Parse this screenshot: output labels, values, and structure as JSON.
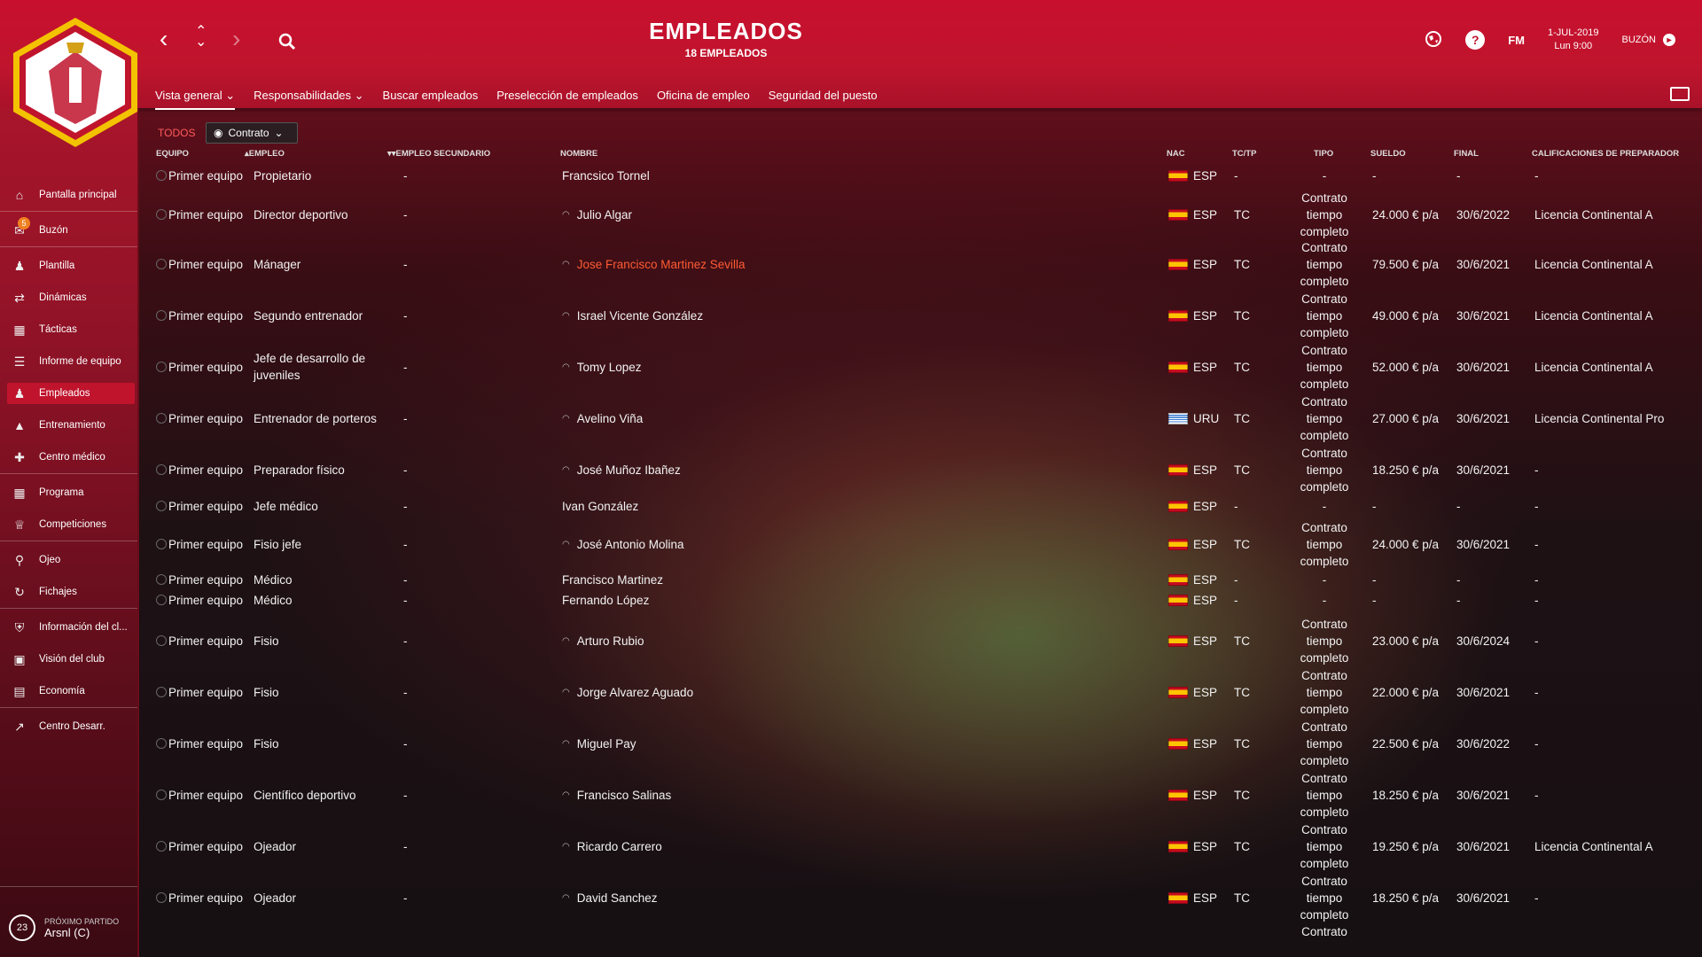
{
  "header": {
    "title": "EMPLEADOS",
    "subtitle": "18 EMPLEADOS",
    "date": "1-JUL-2019",
    "time": "Lun 9:00",
    "fm_label": "FM",
    "mailbox_label": "BUZÓN"
  },
  "tabs": [
    {
      "label": "Vista general"
    },
    {
      "label": "Responsabilidades"
    },
    {
      "label": "Buscar empleados"
    },
    {
      "label": "Preselección de empleados"
    },
    {
      "label": "Oficina de empleo"
    },
    {
      "label": "Seguridad del puesto"
    }
  ],
  "sidebar": {
    "items": [
      {
        "label": "Pantalla principal",
        "icon": "home-icon"
      },
      {
        "label": "Buzón",
        "icon": "inbox-icon",
        "badge": "5"
      },
      {
        "label": "Plantilla",
        "icon": "squad-icon"
      },
      {
        "label": "Dinámicas",
        "icon": "dynamics-icon"
      },
      {
        "label": "Tácticas",
        "icon": "tactics-icon"
      },
      {
        "label": "Informe de equipo",
        "icon": "report-icon"
      },
      {
        "label": "Empleados",
        "icon": "staff-icon"
      },
      {
        "label": "Entrenamiento",
        "icon": "training-icon"
      },
      {
        "label": "Centro médico",
        "icon": "medical-icon"
      },
      {
        "label": "Programa",
        "icon": "calendar-icon"
      },
      {
        "label": "Competiciones",
        "icon": "trophy-icon"
      },
      {
        "label": "Ojeo",
        "icon": "search-icon"
      },
      {
        "label": "Fichajes",
        "icon": "transfers-icon"
      },
      {
        "label": "Información del cl...",
        "icon": "shield-icon"
      },
      {
        "label": "Visión del club",
        "icon": "vision-icon"
      },
      {
        "label": "Economía",
        "icon": "finance-icon"
      },
      {
        "label": "Centro Desarr.",
        "icon": "development-icon"
      }
    ],
    "next_match_label": "PRÓXIMO PARTIDO",
    "next_match_value": "Arsnl (C)",
    "next_match_days": "23"
  },
  "filter": {
    "all_label": "TODOS",
    "view_label": "Contrato"
  },
  "table": {
    "headers": {
      "team": "EQUIPO",
      "job": "EMPLEO",
      "secondary": "EMPLEO SECUNDARIO",
      "name": "NOMBRE",
      "nat": "NAC",
      "tctp": "TC/TP",
      "type": "TIPO",
      "wage": "SUELDO",
      "end": "FINAL",
      "qual": "CALIFICACIONES DE PREPARADOR"
    },
    "rows": [
      {
        "team": "Primer equipo",
        "job": "Propietario",
        "secondary": "-",
        "name": "Francsico Tornel",
        "person": false,
        "nat": "ESP",
        "tctp": "-",
        "type": "-",
        "wage": "-",
        "end": "-",
        "qual": "-"
      },
      {
        "team": "Primer equipo",
        "job": "Director deportivo",
        "secondary": "-",
        "name": "Julio Algar",
        "person": true,
        "nat": "ESP",
        "tctp": "TC",
        "type": "Contrato tiempo completo",
        "wage": "24.000 € p/a",
        "end": "30/6/2022",
        "qual": "Licencia Continental A"
      },
      {
        "team": "Primer equipo",
        "job": "Mánager",
        "secondary": "-",
        "name": "Jose Francisco Martinez Sevilla",
        "person": true,
        "highlight": true,
        "nat": "ESP",
        "tctp": "TC",
        "type": "Contrato tiempo completo",
        "wage": "79.500 € p/a",
        "end": "30/6/2021",
        "qual": "Licencia Continental A"
      },
      {
        "team": "Primer equipo",
        "job": "Segundo entrenador",
        "secondary": "-",
        "name": "Israel Vicente González",
        "person": true,
        "nat": "ESP",
        "tctp": "TC",
        "type": "Contrato tiempo completo",
        "wage": "49.000 € p/a",
        "end": "30/6/2021",
        "qual": "Licencia Continental A"
      },
      {
        "team": "Primer equipo",
        "job": "Jefe de desarrollo de juveniles",
        "secondary": "-",
        "name": "Tomy Lopez",
        "person": true,
        "nat": "ESP",
        "tctp": "TC",
        "type": "Contrato tiempo completo",
        "wage": "52.000 € p/a",
        "end": "30/6/2021",
        "qual": "Licencia Continental A"
      },
      {
        "team": "Primer equipo",
        "job": "Entrenador de porteros",
        "secondary": "-",
        "name": "Avelino Viña",
        "person": true,
        "nat": "URU",
        "tctp": "TC",
        "type": "Contrato tiempo completo",
        "wage": "27.000 € p/a",
        "end": "30/6/2021",
        "qual": "Licencia Continental Pro"
      },
      {
        "team": "Primer equipo",
        "job": "Preparador físico",
        "secondary": "-",
        "name": "José  Muñoz Ibañez",
        "person": true,
        "nat": "ESP",
        "tctp": "TC",
        "type": "Contrato tiempo completo",
        "wage": "18.250 € p/a",
        "end": "30/6/2021",
        "qual": "-"
      },
      {
        "team": "Primer equipo",
        "job": "Jefe médico",
        "secondary": "-",
        "name": "Ivan González",
        "person": false,
        "nat": "ESP",
        "tctp": "-",
        "type": "-",
        "wage": "-",
        "end": "-",
        "qual": "-"
      },
      {
        "team": "Primer equipo",
        "job": "Fisio jefe",
        "secondary": "-",
        "name": "José Antonio Molina",
        "person": true,
        "nat": "ESP",
        "tctp": "TC",
        "type": "Contrato tiempo completo",
        "wage": "24.000 € p/a",
        "end": "30/6/2021",
        "qual": "-"
      },
      {
        "team": "Primer equipo",
        "job": "Médico",
        "secondary": "-",
        "name": "Francisco Martinez",
        "person": false,
        "nat": "ESP",
        "tctp": "-",
        "type": "-",
        "wage": "-",
        "end": "-",
        "qual": "-"
      },
      {
        "team": "Primer equipo",
        "job": "Médico",
        "secondary": "-",
        "name": "Fernando López",
        "person": false,
        "nat": "ESP",
        "tctp": "-",
        "type": "-",
        "wage": "-",
        "end": "-",
        "qual": "-"
      },
      {
        "team": "Primer equipo",
        "job": "Fisio",
        "secondary": "-",
        "name": "Arturo Rubio",
        "person": true,
        "nat": "ESP",
        "tctp": "TC",
        "type": "Contrato tiempo completo",
        "wage": "23.000 € p/a",
        "end": "30/6/2024",
        "qual": "-"
      },
      {
        "team": "Primer equipo",
        "job": "Fisio",
        "secondary": "-",
        "name": "Jorge Alvarez Aguado",
        "person": true,
        "nat": "ESP",
        "tctp": "TC",
        "type": "Contrato tiempo completo",
        "wage": "22.000 € p/a",
        "end": "30/6/2021",
        "qual": "-"
      },
      {
        "team": "Primer equipo",
        "job": "Fisio",
        "secondary": "-",
        "name": "Miguel Pay",
        "person": true,
        "nat": "ESP",
        "tctp": "TC",
        "type": "Contrato tiempo completo",
        "wage": "22.500 € p/a",
        "end": "30/6/2022",
        "qual": "-"
      },
      {
        "team": "Primer equipo",
        "job": "Científico deportivo",
        "secondary": "-",
        "name": "Francisco Salinas",
        "person": true,
        "nat": "ESP",
        "tctp": "TC",
        "type": "Contrato tiempo completo",
        "wage": "18.250 € p/a",
        "end": "30/6/2021",
        "qual": "-"
      },
      {
        "team": "Primer equipo",
        "job": "Ojeador",
        "secondary": "-",
        "name": "Ricardo Carrero",
        "person": true,
        "nat": "ESP",
        "tctp": "TC",
        "type": "Contrato tiempo completo",
        "wage": "19.250 € p/a",
        "end": "30/6/2021",
        "qual": "Licencia Continental A"
      },
      {
        "team": "Primer equipo",
        "job": "Ojeador",
        "secondary": "-",
        "name": "David  Sanchez",
        "person": true,
        "nat": "ESP",
        "tctp": "TC",
        "type": "Contrato tiempo completo",
        "wage": "18.250 € p/a",
        "end": "30/6/2021",
        "qual": "-"
      }
    ],
    "partial_row_type": "Contrato"
  },
  "colors": {
    "accent": "#c0142d",
    "highlight_name": "#ff5a32"
  }
}
